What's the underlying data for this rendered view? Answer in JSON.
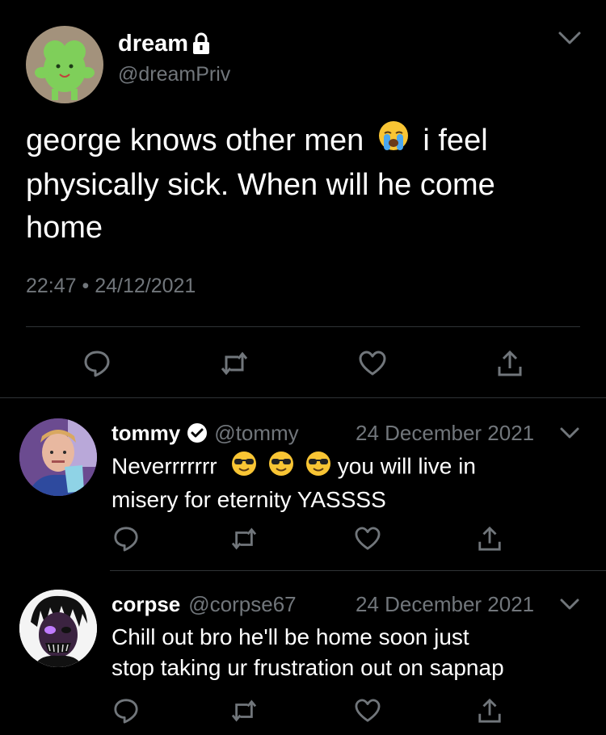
{
  "main_tweet": {
    "display_name": "dream",
    "handle": "@dreamPriv",
    "text_part1": "george knows other men",
    "text_part2": "i feel physically sick. When will he come home",
    "timestamp": "22:47 • 24/12/2021",
    "icons": {
      "lock": "lock-icon",
      "menu": "chevron-down-icon",
      "emoji": "crying-face-emoji"
    }
  },
  "replies": [
    {
      "display_name": "tommy",
      "handle": "@tommy",
      "date": "24 December 2021",
      "text_part1": "Neverrrrrrr",
      "text_part2": "you will live in",
      "text_line2": "misery for eternity YASSSS",
      "verified": true
    },
    {
      "display_name": "corpse",
      "handle": "@corpse67",
      "date": "24 December 2021",
      "text_line1": "Chill out bro he'll be home soon just",
      "text_line2": "stop taking ur frustration out on sapnap",
      "verified": false
    }
  ],
  "actions": [
    "reply-icon",
    "retweet-icon",
    "like-icon",
    "share-icon"
  ],
  "colors": {
    "background": "#000000",
    "text": "#ffffff",
    "secondary_text": "#71767b",
    "divider": "#2f3336"
  }
}
